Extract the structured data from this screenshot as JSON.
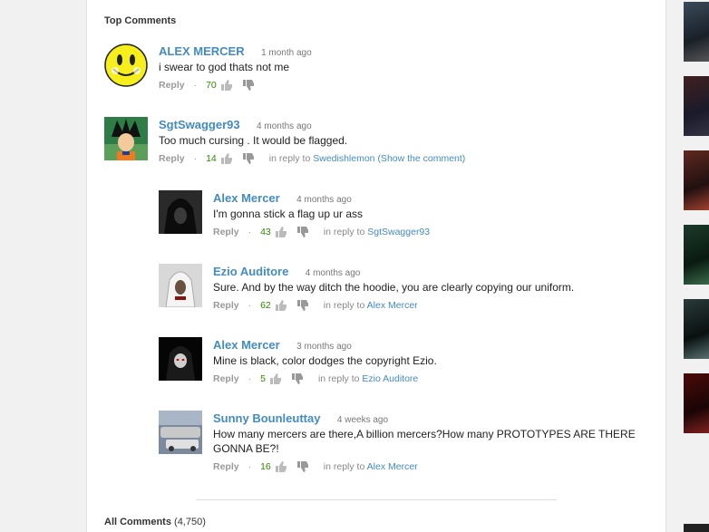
{
  "section_title": "Top Comments",
  "comments": [
    {
      "author": "ALEX MERCER",
      "time": "1 month ago",
      "text": "i swear to god thats not me",
      "reply": "Reply",
      "dot": "·",
      "votes": "70",
      "in_reply": "",
      "in_reply_to": ""
    },
    {
      "author": "SgtSwagger93",
      "time": "4 months ago",
      "text": "Too much cursing . It would be flagged.",
      "reply": "Reply",
      "dot": "·",
      "votes": "14",
      "in_reply": "in reply to",
      "in_reply_to": "Swedishlemon (Show the comment)"
    },
    {
      "author": "Alex Mercer",
      "time": "4 months ago",
      "text": "I'm gonna stick a flag up ur ass",
      "reply": "Reply",
      "dot": "·",
      "votes": "43",
      "in_reply": "in reply to",
      "in_reply_to": "SgtSwagger93"
    },
    {
      "author": "Ezio Auditore",
      "time": "4 months ago",
      "text": "Sure. And by the way ditch the hoodie, you are clearly copying our uniform.",
      "reply": "Reply",
      "dot": "·",
      "votes": "62",
      "in_reply": "in reply to",
      "in_reply_to": "Alex Mercer"
    },
    {
      "author": "Alex Mercer",
      "time": "3 months ago",
      "text": "Mine is black, color dodges the copyright Ezio.",
      "reply": "Reply",
      "dot": "·",
      "votes": "5",
      "in_reply": "in reply to",
      "in_reply_to": "Ezio Auditore"
    },
    {
      "author": "Sunny Bounleuttay",
      "time": "4 weeks ago",
      "text": "How many mercers are there,A billion mercers?How many PROTOTYPES ARE THERE GONNA BE?!",
      "reply": "Reply",
      "dot": "·",
      "votes": "16",
      "in_reply": "in reply to",
      "in_reply_to": "Alex Mercer"
    }
  ],
  "all_comments": {
    "label": "All Comments",
    "count": "(4,750)"
  },
  "colors": {
    "link": "#438bc5",
    "votes": "#2e8b00"
  }
}
